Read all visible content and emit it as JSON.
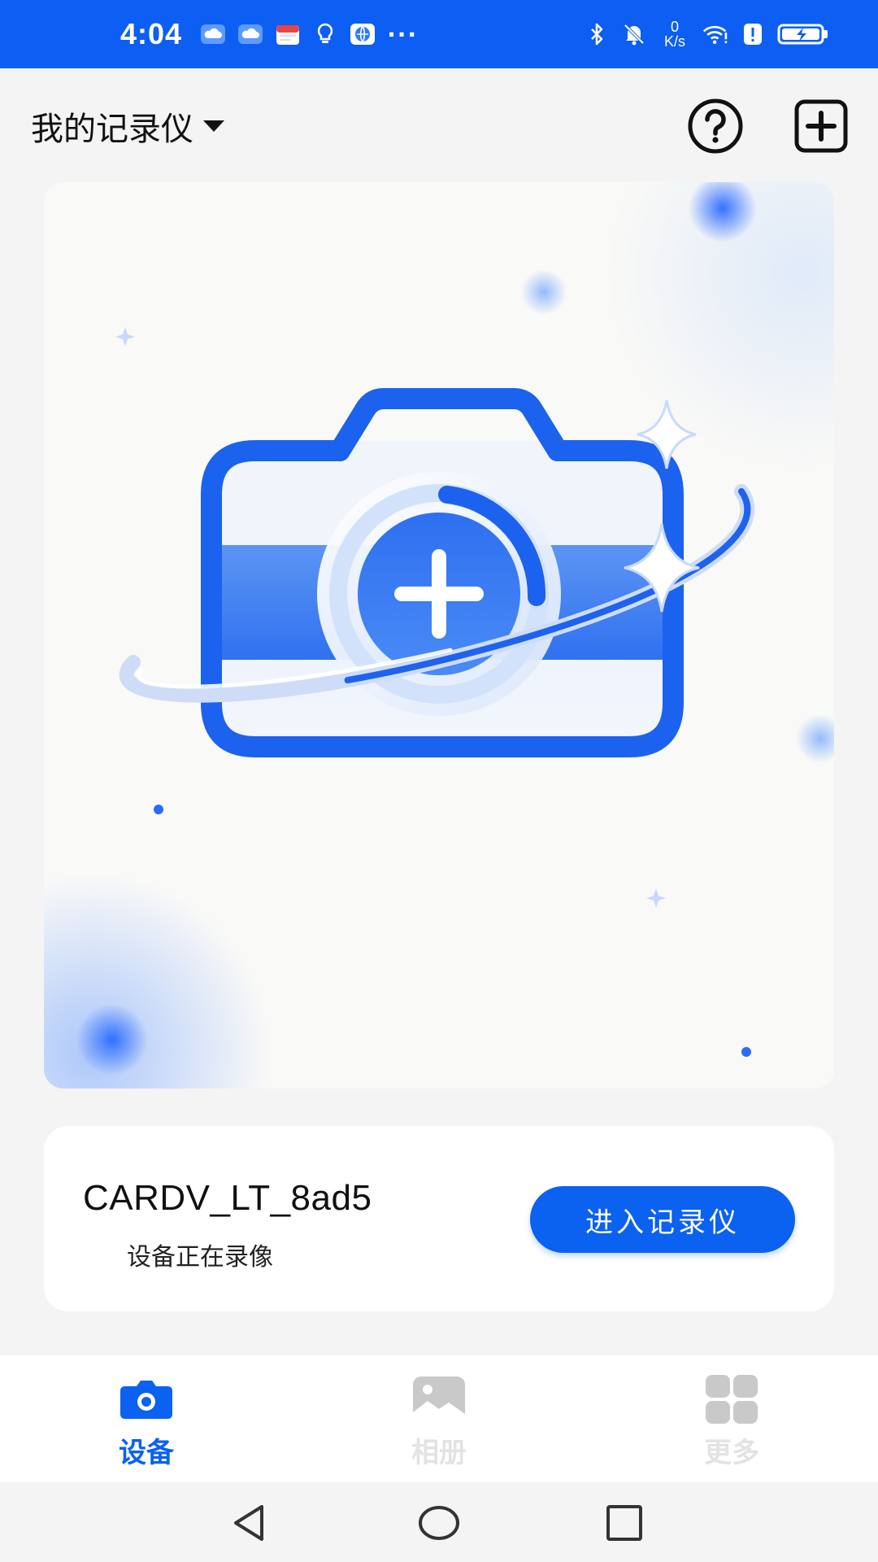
{
  "status_bar": {
    "time": "4:04",
    "net_speed_value": "0",
    "net_speed_unit": "K/s",
    "icons": [
      "cloud-icon",
      "cloud-icon",
      "calendar-icon",
      "lightbulb-icon",
      "browser-icon",
      "more-dots",
      "bluetooth-icon",
      "mute-bell-icon",
      "wifi-icon",
      "alert-icon",
      "battery-charging-icon"
    ],
    "more_indicator": "···"
  },
  "header": {
    "device_selector_label": "我的记录仪",
    "help_icon": "help-circle-icon",
    "add_icon": "add-square-icon"
  },
  "hero": {
    "illustration": "camera-add-illustration"
  },
  "device_card": {
    "name": "CARDV_LT_8ad5",
    "status": "设备正在录像",
    "enter_label": "进入记录仪"
  },
  "tabs": [
    {
      "label": "设备",
      "icon": "camera-icon",
      "active": true
    },
    {
      "label": "相册",
      "icon": "gallery-icon",
      "active": false
    },
    {
      "label": "更多",
      "icon": "grid-icon",
      "active": false
    }
  ],
  "colors": {
    "primary": "#0b61f0",
    "status_bar": "#0d5ef2",
    "background": "#f4f4f4",
    "inactive_tab": "#e3e3e3"
  }
}
